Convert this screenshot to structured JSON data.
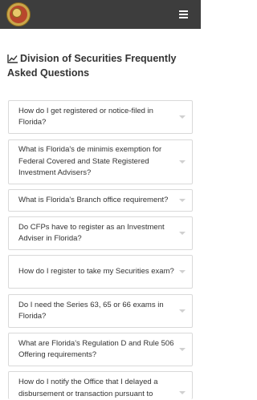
{
  "header": {
    "logo_icon": "florida-seal-icon",
    "menu_icon": "hamburger-menu-icon"
  },
  "page": {
    "title": "Division of Securities Frequently Asked Questions",
    "title_icon": "line-chart-icon"
  },
  "faqs": [
    {
      "question": "How do I get registered or notice-filed in Florida?"
    },
    {
      "question": "What is Florida's de minimis exemption for Federal Covered and State Registered Investment Advisers?"
    },
    {
      "question": "What is Florida's Branch office requirement?"
    },
    {
      "question": "Do CFPs have to register as an Investment Adviser in Florida?"
    },
    {
      "question": "How do I register to take my Securities exam?"
    },
    {
      "question": "Do I need the Series 63, 65 or 66 exams in Florida?"
    },
    {
      "question": "What are Florida's Regulation D and Rule 506 Offering requirements?"
    },
    {
      "question": "How do I notify the Office that I delayed a disbursement or transaction pursuant to"
    }
  ],
  "colors": {
    "topbar": "#3d3d3d",
    "border": "#d9d9d9"
  }
}
